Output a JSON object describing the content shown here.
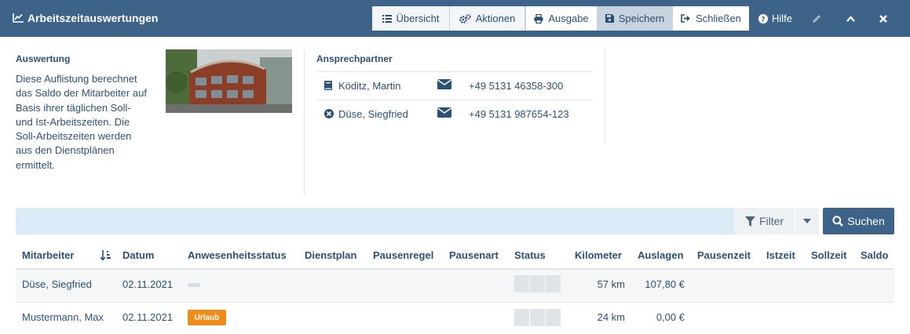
{
  "header": {
    "title": "Arbeitszeitauswertungen",
    "toolbar": [
      {
        "label": "Übersicht",
        "icon": "list-icon"
      },
      {
        "label": "Aktionen",
        "icon": "cogs-icon"
      },
      {
        "label": "Ausgabe",
        "icon": "print-icon"
      },
      {
        "label": "Speichern",
        "icon": "save-icon"
      },
      {
        "label": "Schließen",
        "icon": "sign-out-icon"
      }
    ],
    "help_label": "Hilfe"
  },
  "evaluation": {
    "heading": "Auswertung",
    "description": "Diese Auflistung berechnet das Saldo der Mitarbeiter auf Basis ihrer täglichen Soll- und Ist-Arbeitszeiten. Die Soll-Arbeitszeiten werden aus den Dienstplänen ermittelt."
  },
  "contacts": {
    "heading": "Ansprechpartner",
    "items": [
      {
        "name": "Köditz, Martin",
        "phone": "+49 5131 46358-300",
        "icon": "book-icon"
      },
      {
        "name": "Düse, Siegfried",
        "phone": "+49 5131 987654-123",
        "icon": "circle-x-icon"
      }
    ]
  },
  "filter": {
    "filter_label": "Filter",
    "search_label": "Suchen"
  },
  "table": {
    "columns": [
      "Mitarbeiter",
      "Datum",
      "Anwesenheitsstatus",
      "Dienstplan",
      "Pausenregel",
      "Pausenart",
      "Status",
      "Kilometer",
      "Auslagen",
      "Pausenzeit",
      "Istzeit",
      "Sollzeit",
      "Saldo"
    ],
    "rows": [
      {
        "mitarbeiter": "Düse, Siegfried",
        "datum": "02.11.2021",
        "anwesenheit": "",
        "kilometer": "57 km",
        "auslagen": "107,80 €"
      },
      {
        "mitarbeiter": "Mustermann, Max",
        "datum": "02.11.2021",
        "anwesenheit": "Urlaub",
        "kilometer": "24 km",
        "auslagen": "0,00 €"
      }
    ]
  },
  "colors": {
    "header_bg": "#3d6389",
    "badge_urlaub": "#f28c18",
    "filter_bg": "#d9ebf7"
  }
}
